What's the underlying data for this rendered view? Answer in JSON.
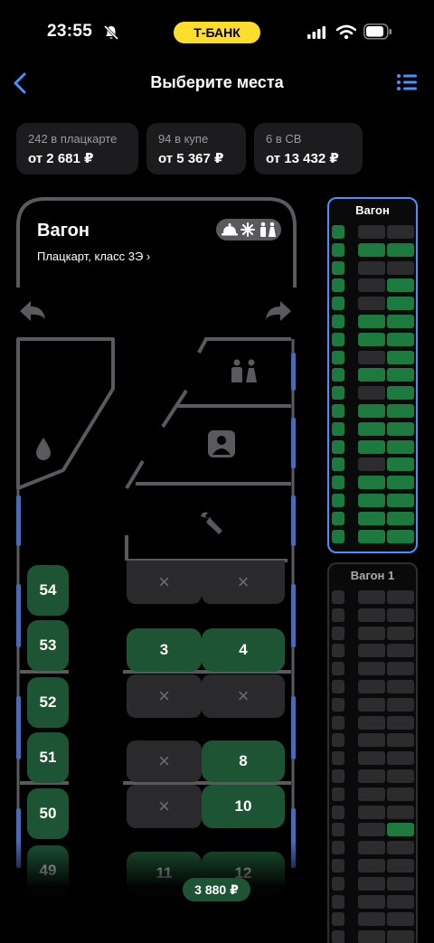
{
  "status_bar": {
    "time": "23:55",
    "bank": "Т-БАНК"
  },
  "header": {
    "title": "Выберите места"
  },
  "price_cards": [
    {
      "label": "242 в плацкарте",
      "price": "от 2 681 ₽"
    },
    {
      "label": "94 в купе",
      "price": "от 5 367 ₽"
    },
    {
      "label": "6 в СВ",
      "price": "от 13 432 ₽"
    }
  ],
  "wagon": {
    "name": "Вагон",
    "class": "Плацкарт, класс 3Э ›"
  },
  "side_seats": [
    {
      "number": "54",
      "state": "free"
    },
    {
      "number": "53",
      "state": "free"
    },
    {
      "number": "52",
      "state": "free"
    },
    {
      "number": "51",
      "state": "free"
    },
    {
      "number": "50",
      "state": "free"
    },
    {
      "number": "49",
      "state": "free"
    }
  ],
  "compartments": [
    {
      "upper_left": "×",
      "upper_right": "×",
      "lower_left": "",
      "lower_right": ""
    },
    {
      "upper_left": "3",
      "upper_right": "4",
      "lower_left": "×",
      "lower_right": "×"
    },
    {
      "upper_left": "×",
      "upper_right": "8",
      "lower_left": "×",
      "lower_right": "10"
    },
    {
      "upper_left": "11",
      "upper_right": "12"
    }
  ],
  "minimap": {
    "active_title": "Вагон",
    "next_title": "Вагон 1"
  },
  "total_price": "3 880 ₽",
  "colors": {
    "accent_free": "#1d5534",
    "taken": "#2a2a2c",
    "link_blue": "#4a90ff",
    "bank_yellow": "#ffdd2d",
    "wall": "#5a5a5e",
    "window": "#4a6ab4"
  }
}
